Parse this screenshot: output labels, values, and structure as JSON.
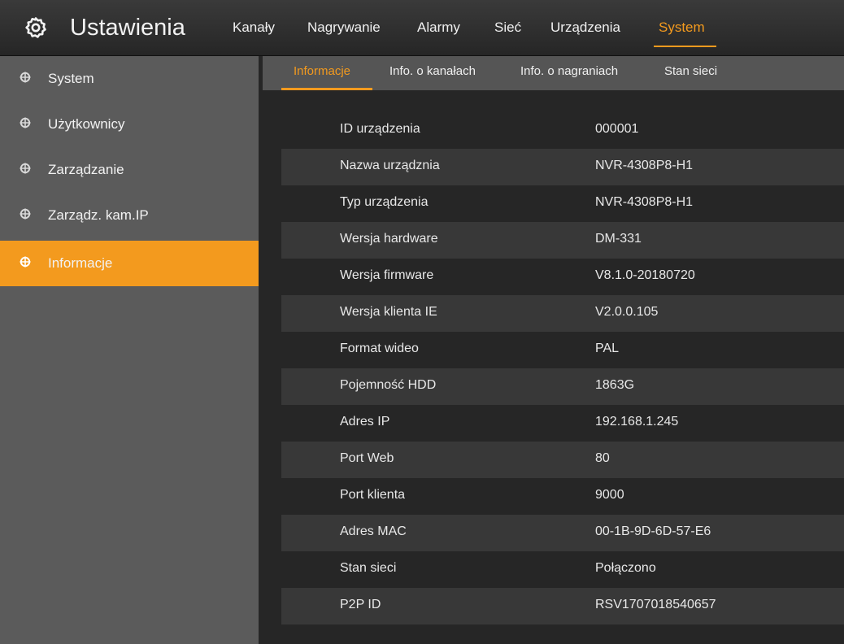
{
  "header": {
    "title": "Ustawienia",
    "icon": "gear-icon",
    "accent_color": "#f39a1e",
    "tabs": [
      {
        "label": "Kanały"
      },
      {
        "label": "Nagrywanie"
      },
      {
        "label": "Alarmy"
      },
      {
        "label": "Sieć"
      },
      {
        "label": "Urządzenia"
      },
      {
        "label": "System",
        "active": true
      }
    ]
  },
  "sidebar": {
    "items": [
      {
        "label": "System"
      },
      {
        "label": "Użytkownicy"
      },
      {
        "label": "Zarządzanie"
      },
      {
        "label": "Zarządz. kam.IP"
      },
      {
        "label": "Informacje",
        "active": true
      }
    ]
  },
  "subtabs": [
    {
      "label": "Informacje",
      "active": true
    },
    {
      "label": "Info. o kanałach"
    },
    {
      "label": "Info. o nagraniach"
    },
    {
      "label": "Stan sieci"
    }
  ],
  "info_rows": [
    {
      "label": "ID urządzenia",
      "value": "000001"
    },
    {
      "label": "Nazwa urządznia",
      "value": "NVR-4308P8-H1"
    },
    {
      "label": "Typ urządzenia",
      "value": "NVR-4308P8-H1"
    },
    {
      "label": "Wersja hardware",
      "value": "DM-331"
    },
    {
      "label": "Wersja firmware",
      "value": "V8.1.0-20180720"
    },
    {
      "label": "Wersja klienta IE",
      "value": "V2.0.0.105"
    },
    {
      "label": "Format wideo",
      "value": "PAL"
    },
    {
      "label": "Pojemność HDD",
      "value": "1863G"
    },
    {
      "label": "Adres IP",
      "value": "192.168.1.245"
    },
    {
      "label": "Port Web",
      "value": "80"
    },
    {
      "label": "Port klienta",
      "value": "9000"
    },
    {
      "label": "Adres MAC",
      "value": "00-1B-9D-6D-57-E6"
    },
    {
      "label": "Stan sieci",
      "value": "Połączono"
    },
    {
      "label": "P2P ID",
      "value": "RSV1707018540657"
    }
  ]
}
